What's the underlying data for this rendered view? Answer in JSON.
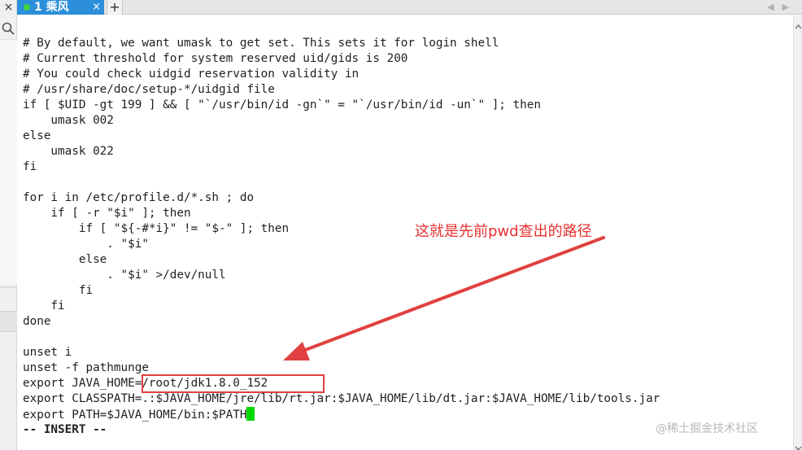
{
  "sidebar": {
    "close_glyph": "×"
  },
  "tabbar": {
    "active_tab_label": "1 乘风",
    "close_glyph": "×",
    "add_glyph": "+",
    "nav_left": "◀",
    "nav_right": "▶"
  },
  "editor": {
    "lines": [
      "# By default, we want umask to get set. This sets it for login shell",
      "# Current threshold for system reserved uid/gids is 200",
      "# You could check uidgid reservation validity in",
      "# /usr/share/doc/setup-*/uidgid file",
      "if [ $UID -gt 199 ] && [ \"`/usr/bin/id -gn`\" = \"`/usr/bin/id -un`\" ]; then",
      "    umask 002",
      "else",
      "    umask 022",
      "fi",
      "",
      "for i in /etc/profile.d/*.sh ; do",
      "    if [ -r \"$i\" ]; then",
      "        if [ \"${-#*i}\" != \"$-\" ]; then",
      "            . \"$i\"",
      "        else",
      "            . \"$i\" >/dev/null",
      "        fi",
      "    fi",
      "done",
      "",
      "unset i",
      "unset -f pathmunge",
      "export JAVA_HOME=/root/jdk1.8.0_152",
      "export CLASSPATH=.:$JAVA_HOME/jre/lib/rt.jar:$JAVA_HOME/lib/dt.jar:$JAVA_HOME/lib/tools.jar",
      "export PATH=$JAVA_HOME/bin:$PATH"
    ],
    "mode_line": "-- INSERT --"
  },
  "annotation": {
    "text": "这就是先前pwd查出的路径",
    "color": "#e8302f"
  },
  "watermark": {
    "text": "@稀土掘金技术社区"
  },
  "colors": {
    "tab_active": "#2b8fd9",
    "cursor": "#00d800",
    "status_dot": "#3fd43f",
    "highlight": "#e0403f"
  },
  "icons": {
    "sidebar_search": "search-icon",
    "tab_close": "close-icon",
    "tab_add": "plus-icon",
    "scroll_up": "chevron-up-icon",
    "scroll_down": "chevron-down-icon"
  }
}
